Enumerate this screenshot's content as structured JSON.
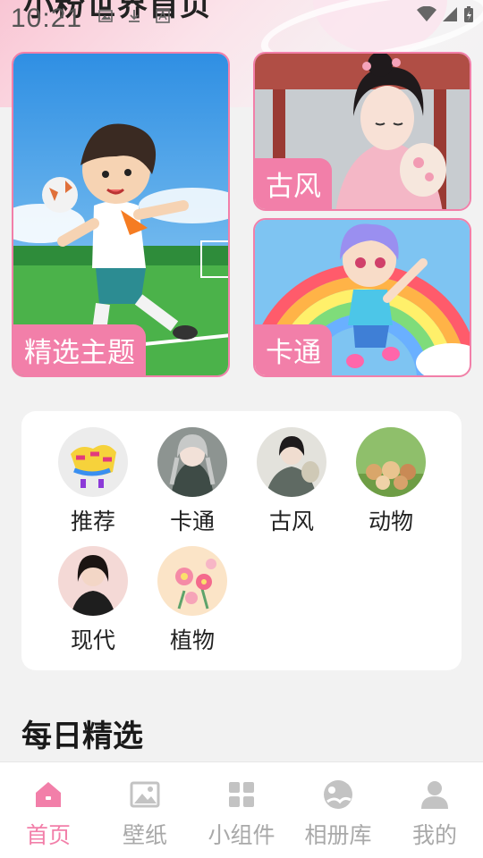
{
  "status_bar": {
    "time": "10:21"
  },
  "page": {
    "title": "小粉世界首页"
  },
  "featured": {
    "main": {
      "label": "精选主题"
    },
    "side_top": {
      "label": "古风"
    },
    "side_bottom": {
      "label": "卡通"
    }
  },
  "categories": [
    {
      "label": "推荐",
      "icon": "graffiti-thumb"
    },
    {
      "label": "卡通",
      "icon": "anime-girl-thumb"
    },
    {
      "label": "古风",
      "icon": "ancient-style-thumb"
    },
    {
      "label": "动物",
      "icon": "animals-thumb"
    },
    {
      "label": "现代",
      "icon": "modern-portrait-thumb"
    },
    {
      "label": "植物",
      "icon": "flowers-thumb"
    }
  ],
  "daily": {
    "title": "每日精选"
  },
  "tabs": [
    {
      "label": "首页",
      "icon": "home-icon",
      "active": true
    },
    {
      "label": "壁纸",
      "icon": "image-icon",
      "active": false
    },
    {
      "label": "小组件",
      "icon": "widgets-icon",
      "active": false
    },
    {
      "label": "相册库",
      "icon": "album-icon",
      "active": false
    },
    {
      "label": "我的",
      "icon": "person-icon",
      "active": false
    }
  ],
  "colors": {
    "accent": "#f27fa9",
    "inactive": "#a9a9a9",
    "background": "#f2f2f2"
  }
}
